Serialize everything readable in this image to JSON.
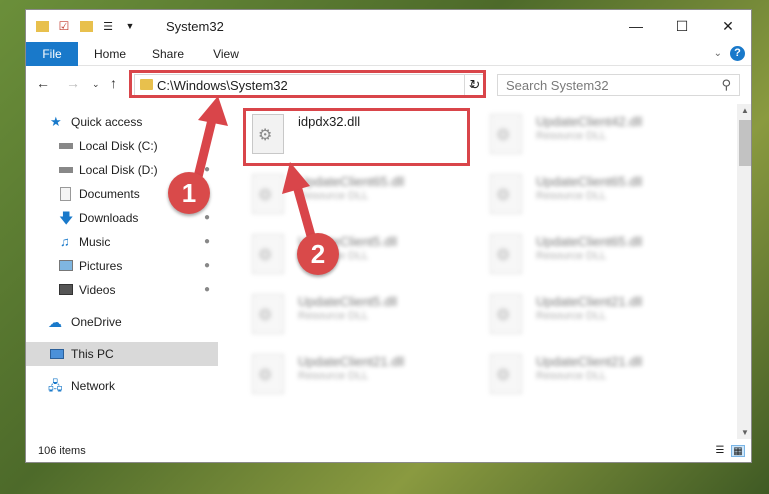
{
  "window": {
    "title": "System32"
  },
  "tabs": {
    "file": "File",
    "home": "Home",
    "share": "Share",
    "view": "View"
  },
  "address": {
    "path": "C:\\Windows\\System32"
  },
  "search": {
    "placeholder": "Search System32"
  },
  "sidebar": {
    "items": [
      {
        "label": "Quick access"
      },
      {
        "label": "Local Disk (C:)"
      },
      {
        "label": "Local Disk (D:)"
      },
      {
        "label": "Documents"
      },
      {
        "label": "Downloads"
      },
      {
        "label": "Music"
      },
      {
        "label": "Pictures"
      },
      {
        "label": "Videos"
      },
      {
        "label": "OneDrive"
      },
      {
        "label": "This PC"
      },
      {
        "label": "Network"
      }
    ]
  },
  "files": [
    {
      "name": "idpdx32.dll",
      "type": ""
    },
    {
      "name": "UpdateClient42.dll",
      "type": "Resource DLL"
    },
    {
      "name": "UpdateClient65.dll",
      "type": "Resource DLL"
    },
    {
      "name": "UpdateClient65.dll",
      "type": "Resource DLL"
    },
    {
      "name": "UpdateClient5.dll",
      "type": "Resource DLL"
    },
    {
      "name": "UpdateClient65.dll",
      "type": "Resource DLL"
    },
    {
      "name": "UpdateClient5.dll",
      "type": "Resource DLL"
    },
    {
      "name": "UpdateClient21.dll",
      "type": "Resource DLL"
    },
    {
      "name": "UpdateClient21.dll",
      "type": "Resource DLL"
    },
    {
      "name": "UpdateClient21.dll",
      "type": "Resource DLL"
    }
  ],
  "status": {
    "count": "106 items"
  },
  "annotations": {
    "step1": "1",
    "step2": "2"
  },
  "colors": {
    "accent": "#1979ca",
    "highlight": "#d9454a"
  }
}
